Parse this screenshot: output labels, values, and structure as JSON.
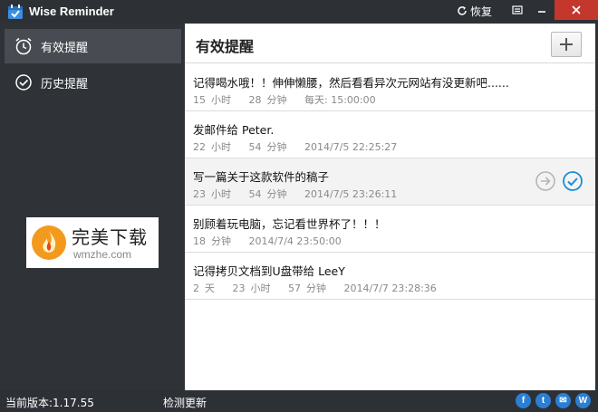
{
  "window": {
    "title": "Wise Reminder",
    "restore_label": "恢复"
  },
  "sidebar": {
    "items": [
      {
        "label": "有效提醒",
        "icon": "alarm-clock-icon",
        "active": true
      },
      {
        "label": "历史提醒",
        "icon": "check-circle-icon",
        "active": false
      }
    ],
    "ad": {
      "name_cn": "完美下载",
      "domain": "wmzhe.com"
    }
  },
  "main": {
    "title": "有效提醒",
    "reminders": [
      {
        "title": "记得喝水哦！！伸伸懒腰，然后看看异次元网站有没更新吧......",
        "remaining_h": "15",
        "h_unit": "小时",
        "remaining_m": "28",
        "m_unit": "分钟",
        "when": "每天: 15:00:00"
      },
      {
        "title": "发邮件给 Peter.",
        "remaining_h": "22",
        "h_unit": "小时",
        "remaining_m": "54",
        "m_unit": "分钟",
        "when": "2014/7/5 22:25:27"
      },
      {
        "title": "写一篇关于这款软件的稿子",
        "remaining_h": "23",
        "h_unit": "小时",
        "remaining_m": "54",
        "m_unit": "分钟",
        "when": "2014/7/5 23:26:11"
      },
      {
        "title": "别顾着玩电脑，忘记看世界杯了！！！",
        "remaining_m": "18",
        "m_unit": "分钟",
        "when": "2014/7/4 23:50:00"
      },
      {
        "title": "记得拷贝文档到U盘带给 LeeY",
        "remaining_d": "2",
        "d_unit": "天",
        "remaining_h": "23",
        "h_unit": "小时",
        "remaining_m": "57",
        "m_unit": "分钟",
        "when": "2014/7/7 23:28:36"
      }
    ]
  },
  "status": {
    "version": "当前版本:1.17.55",
    "check_update": "检测更新",
    "social": [
      "f",
      "t",
      "✉",
      "W"
    ]
  },
  "colors": {
    "accent": "#1a8fd8",
    "close": "#c4372c",
    "chrome": "#2f3338"
  }
}
